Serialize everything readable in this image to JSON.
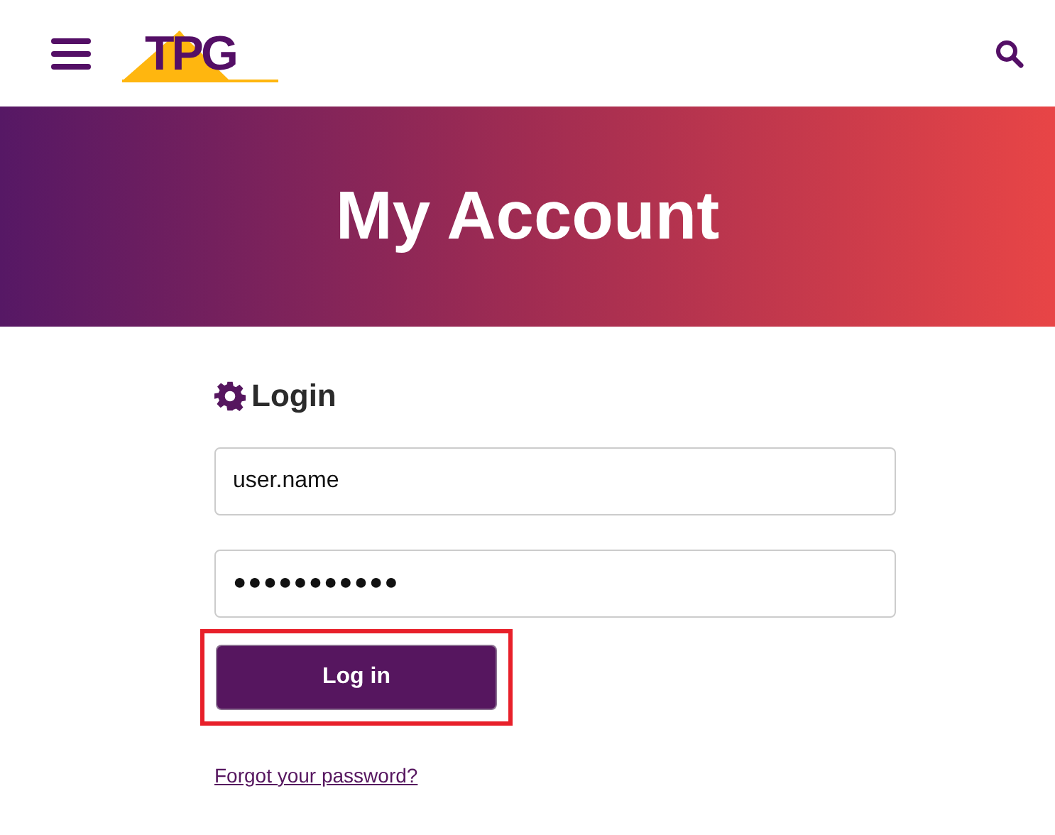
{
  "header": {
    "logo": "TPG"
  },
  "banner": {
    "title": "My Account"
  },
  "login": {
    "heading": "Login",
    "username": {
      "value": "user.name"
    },
    "password": {
      "value": "●●●●●●●●●●●"
    },
    "button": {
      "label": "Log in",
      "highlighted": true
    },
    "forgot_link": "Forgot your password?"
  }
}
